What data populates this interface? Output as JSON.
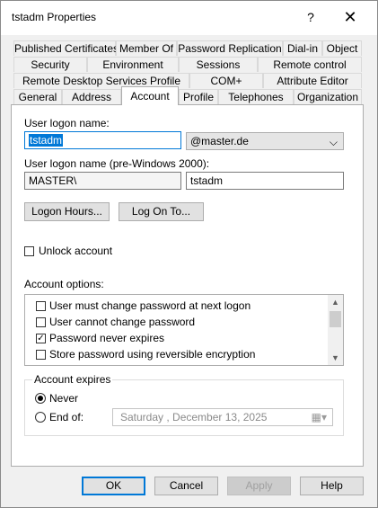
{
  "window": {
    "title": "tstadm Properties",
    "help_glyph": "?",
    "close_glyph": "✕"
  },
  "tabs": {
    "row1": [
      "Published Certificates",
      "Member Of",
      "Password Replication",
      "Dial-in",
      "Object"
    ],
    "row2": [
      "Security",
      "Environment",
      "Sessions",
      "Remote control"
    ],
    "row3": [
      "Remote Desktop Services Profile",
      "COM+",
      "Attribute Editor"
    ],
    "row4": [
      "General",
      "Address",
      "Account",
      "Profile",
      "Telephones",
      "Organization"
    ],
    "active": "Account"
  },
  "account": {
    "logon_name_label": "User logon name:",
    "logon_name_value": "tstadm",
    "domain_value": "@master.de",
    "pre2000_label": "User logon name (pre-Windows 2000):",
    "pre2000_domain": "MASTER\\",
    "pre2000_user": "tstadm",
    "logon_hours_btn": "Logon Hours...",
    "logon_to_btn": "Log On To...",
    "unlock_label": "Unlock account",
    "options_label": "Account options:",
    "options": [
      {
        "label": "User must change password at next logon",
        "checked": false
      },
      {
        "label": "User cannot change password",
        "checked": false
      },
      {
        "label": "Password never expires",
        "checked": true
      },
      {
        "label": "Store password using reversible encryption",
        "checked": false
      }
    ],
    "expires_label": "Account expires",
    "never_label": "Never",
    "endof_label": "End of:",
    "endof_date": "Saturday   , December 13, 2025"
  },
  "footer": {
    "ok": "OK",
    "cancel": "Cancel",
    "apply": "Apply",
    "help": "Help"
  },
  "glyphs": {
    "check": "✓",
    "chevron_down": "⌵",
    "scroll_up": "▲",
    "scroll_down": "▼",
    "calendar": "▦▾"
  }
}
